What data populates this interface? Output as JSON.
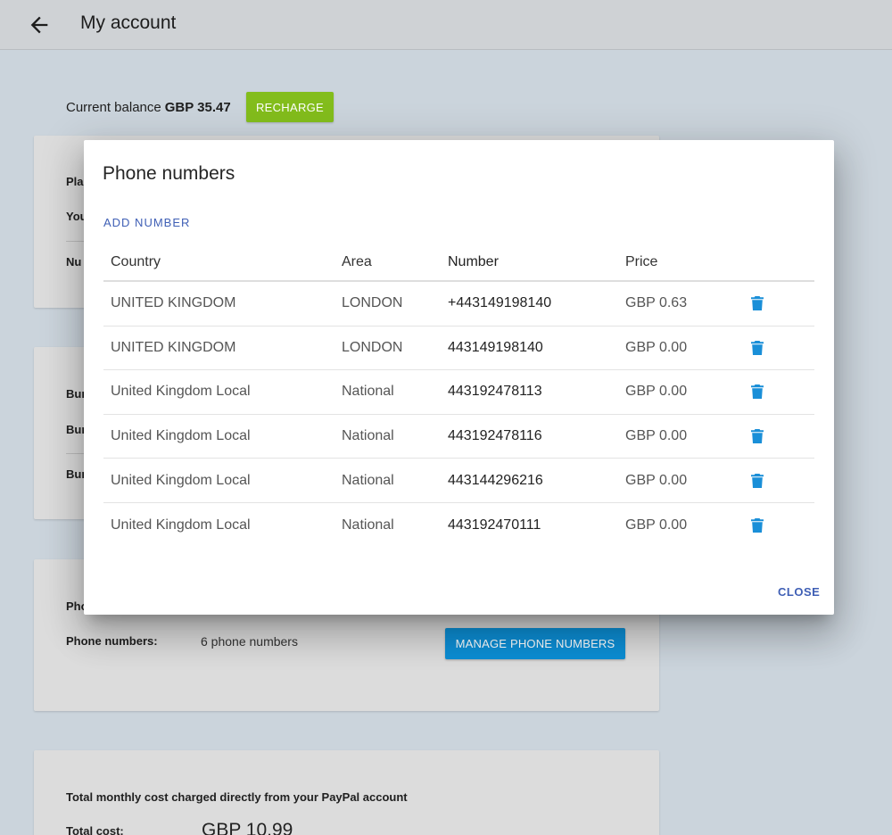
{
  "header": {
    "title": "My account",
    "back_icon": "arrow-left-icon"
  },
  "balance": {
    "label": "Current balance",
    "amount": "GBP 35.47",
    "recharge_label": "RECHARGE",
    "recharge_color": "#83bd1c"
  },
  "plan_card": {
    "clipped_labels": [
      "Pla",
      "You",
      "Nu"
    ]
  },
  "bundles_card": {
    "clipped_labels": [
      "Bur",
      "Bur",
      "Bur"
    ]
  },
  "phones_card": {
    "clipped_heading": "Pho",
    "label": "Phone numbers:",
    "value": "6 phone numbers",
    "manage_label": "MANAGE PHONE NUMBERS",
    "manage_color": "#0d8ed4"
  },
  "total_card": {
    "description": "Total monthly cost charged directly from your PayPal account",
    "label": "Total cost:",
    "value": "GBP 10.99"
  },
  "dialog": {
    "title": "Phone numbers",
    "add_label": "ADD NUMBER",
    "columns": {
      "country": "Country",
      "area": "Area",
      "number": "Number",
      "price": "Price"
    },
    "rows": [
      {
        "country": "UNITED KINGDOM",
        "area": "LONDON",
        "number": "+443149198140",
        "price": "GBP 0.63"
      },
      {
        "country": "UNITED KINGDOM",
        "area": "LONDON",
        "number": "443149198140",
        "price": "GBP 0.00"
      },
      {
        "country": "United Kingdom Local",
        "area": "National",
        "number": "443192478113",
        "price": "GBP 0.00"
      },
      {
        "country": "United Kingdom Local",
        "area": "National",
        "number": "443192478116",
        "price": "GBP 0.00"
      },
      {
        "country": "United Kingdom Local",
        "area": "National",
        "number": "443144296216",
        "price": "GBP 0.00"
      },
      {
        "country": "United Kingdom Local",
        "area": "National",
        "number": "443192470111",
        "price": "GBP 0.00"
      }
    ],
    "delete_icon": "trash-icon",
    "delete_color": "#1a8fd8",
    "close_label": "CLOSE"
  }
}
